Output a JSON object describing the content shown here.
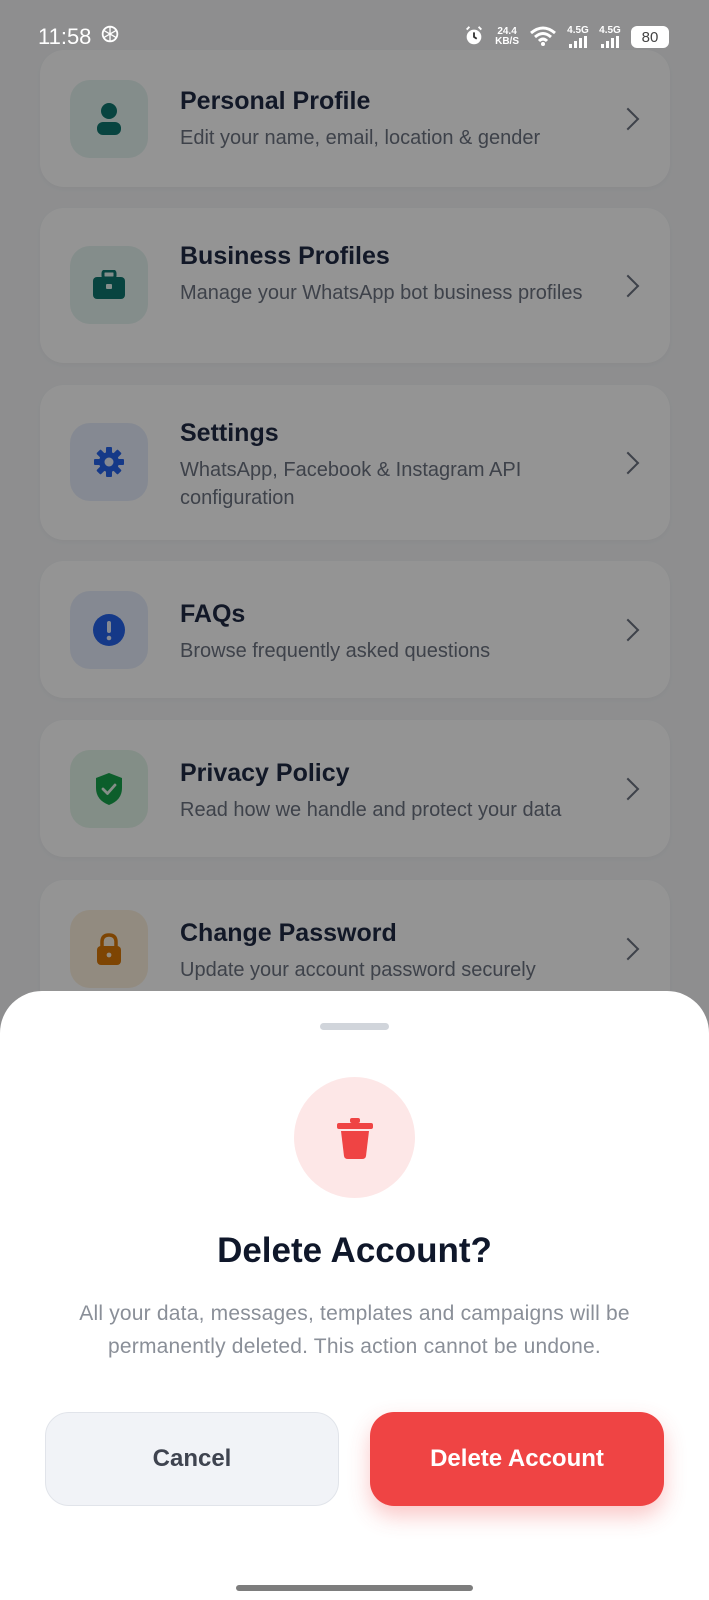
{
  "status_bar": {
    "time": "11:58",
    "net_speed_value": "24.4",
    "net_speed_unit": "KB/S",
    "sim1": "4.5G",
    "sim2": "4.5G",
    "battery": "80"
  },
  "menu": {
    "items": [
      {
        "title": "Personal Profile",
        "subtitle": "Edit your name, email, location & gender",
        "icon": "person-icon"
      },
      {
        "title": "Business Profiles",
        "subtitle": "Manage your WhatsApp bot business profiles",
        "icon": "briefcase-icon"
      },
      {
        "title": "Settings",
        "subtitle": "WhatsApp, Facebook & Instagram API configuration",
        "icon": "gear-icon"
      },
      {
        "title": "FAQs",
        "subtitle": "Browse frequently asked questions",
        "icon": "info-icon"
      },
      {
        "title": "Privacy Policy",
        "subtitle": "Read how we handle and protect your data",
        "icon": "shield-check-icon"
      },
      {
        "title": "Change Password",
        "subtitle": "Update your account password securely",
        "icon": "lock-icon"
      }
    ]
  },
  "dialog": {
    "title": "Delete Account?",
    "message": "All your data, messages, templates and campaigns will be permanently deleted. This action cannot be undone.",
    "cancel_label": "Cancel",
    "confirm_label": "Delete Account",
    "icon": "trash-icon"
  },
  "colors": {
    "danger": "#ef4444",
    "danger_soft": "#fde7e7",
    "title": "#0f172a",
    "overlay": "rgba(0,0,0,0.42)"
  }
}
